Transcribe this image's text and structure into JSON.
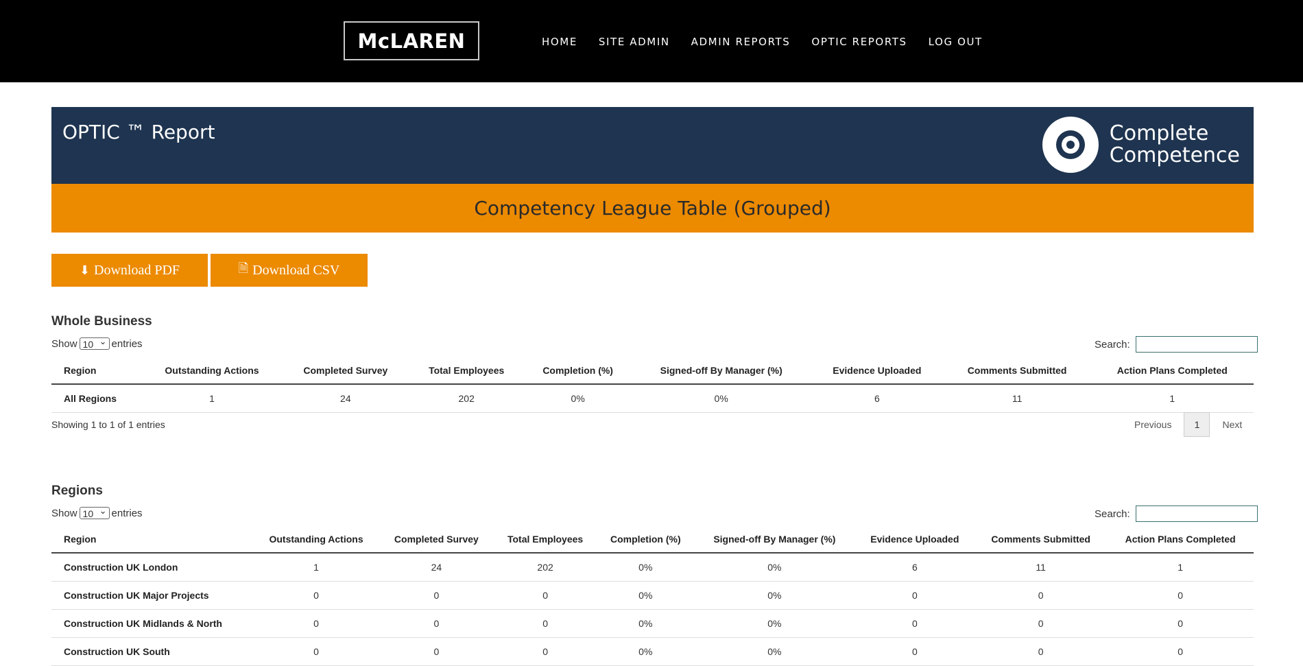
{
  "nav": {
    "logo": "McLAREN",
    "items": [
      "HOME",
      "SITE ADMIN",
      "ADMIN REPORTS",
      "OPTIC REPORTS",
      "LOG OUT"
    ]
  },
  "header": {
    "title": "OPTIC ™ Report",
    "brand_line1": "Complete",
    "brand_line2": "Competence"
  },
  "band": {
    "title": "Competency League Table (Grouped)"
  },
  "buttons": {
    "pdf": "Download PDF",
    "csv": "Download CSV"
  },
  "common": {
    "show": "Show",
    "entries": "entries",
    "page_size": "10",
    "search_label": "Search:"
  },
  "whole": {
    "title": "Whole Business",
    "columns": [
      "Region",
      "Outstanding Actions",
      "Completed Survey",
      "Total Employees",
      "Completion (%)",
      "Signed-off By Manager (%)",
      "Evidence Uploaded",
      "Comments Submitted",
      "Action Plans Completed"
    ],
    "rows": [
      [
        "All Regions",
        "1",
        "24",
        "202",
        "0%",
        "0%",
        "6",
        "11",
        "1"
      ]
    ],
    "info": "Showing 1 to 1 of 1 entries",
    "pager": {
      "prev": "Previous",
      "page": "1",
      "next": "Next"
    }
  },
  "regions": {
    "title": "Regions",
    "columns": [
      "Region",
      "Outstanding Actions",
      "Completed Survey",
      "Total Employees",
      "Completion (%)",
      "Signed-off By Manager (%)",
      "Evidence Uploaded",
      "Comments Submitted",
      "Action Plans Completed"
    ],
    "rows": [
      [
        "Construction UK London",
        "1",
        "24",
        "202",
        "0%",
        "0%",
        "6",
        "11",
        "1"
      ],
      [
        "Construction UK Major Projects",
        "0",
        "0",
        "0",
        "0%",
        "0%",
        "0",
        "0",
        "0"
      ],
      [
        "Construction UK Midlands & North",
        "0",
        "0",
        "0",
        "0%",
        "0%",
        "0",
        "0",
        "0"
      ],
      [
        "Construction UK South",
        "0",
        "0",
        "0",
        "0%",
        "0%",
        "0",
        "0",
        "0"
      ]
    ]
  },
  "colors": {
    "navy": "#1e3450",
    "orange": "#ec8a00",
    "black": "#000000"
  }
}
